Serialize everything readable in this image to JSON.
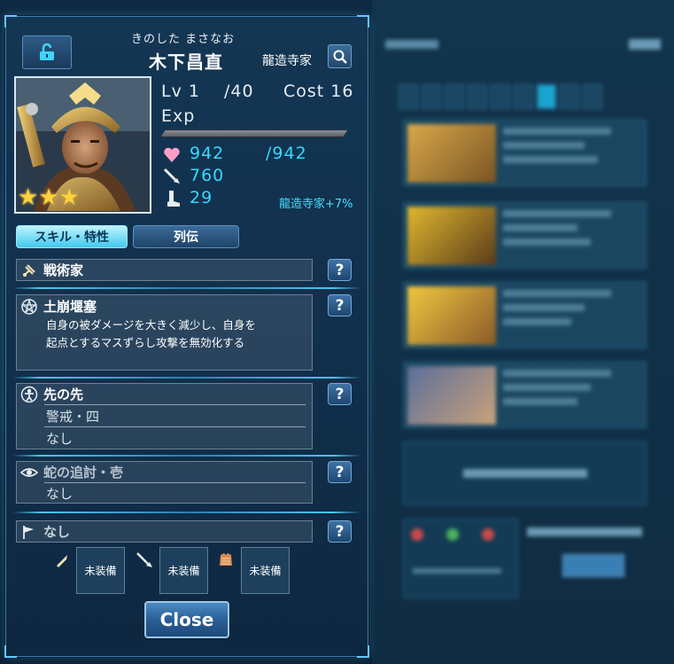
{
  "character": {
    "furigana": "きのした まさなお",
    "name": "木下昌直",
    "clan": "龍造寺家",
    "stars": 3
  },
  "stats": {
    "lv_label": "Lv 1",
    "lv_max": "/40",
    "cost_label": "Cost 16",
    "exp_label": "Exp",
    "hp": "942",
    "hp_max": "/942",
    "attack": "760",
    "defense": "29",
    "clan_bonus": "龍造寺家+7%"
  },
  "tabs": {
    "skills": "スキル・特性",
    "biography": "列伝"
  },
  "sections": {
    "tactician": "戦術家",
    "skill_name": "土崩堰塞",
    "skill_desc_1": "自身の被ダメージを大きく減少し、自身を",
    "skill_desc_2": "起点とするマスずらし攻撃を無効化する",
    "trait_name": "先の先",
    "trait_sub1": "警戒・四",
    "trait_sub2": "なし",
    "pursuit_name": "蛇の追討・壱",
    "pursuit_sub": "なし",
    "flag_text": "なし"
  },
  "help_label": "?",
  "equipment": {
    "slot1": "未装備",
    "slot2": "未装備",
    "slot3": "未装備"
  },
  "close_label": "Close",
  "colors": {
    "accent_cyan": "#35d9ff",
    "heart_pink": "#ff9fc8",
    "star_gold": "#ffd23c"
  }
}
